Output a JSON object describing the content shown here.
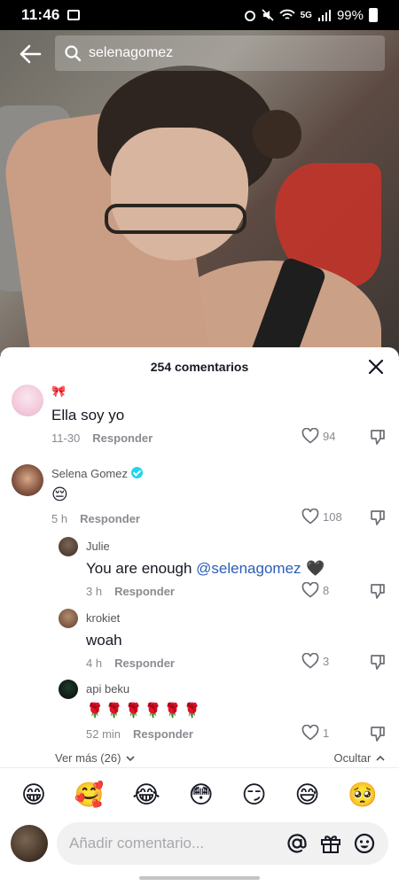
{
  "status_bar": {
    "time": "11:46",
    "network": "5G",
    "battery": "99%"
  },
  "search": {
    "query": "selenagomez"
  },
  "comments_sheet": {
    "title": "254 comentarios",
    "comments": [
      {
        "username": "🎀",
        "text": "Ella soy yo",
        "date": "11-30",
        "reply_label": "Responder",
        "likes": "94"
      },
      {
        "username": "Selena Gomez",
        "verified": true,
        "text": "😔",
        "date": "5 h",
        "reply_label": "Responder",
        "likes": "108",
        "replies": [
          {
            "username": "Julie",
            "text_before": "You are enough ",
            "mention": "@selenagomez",
            "text_after": " 🖤",
            "date": "3 h",
            "reply_label": "Responder",
            "likes": "8"
          },
          {
            "username": "krokiet",
            "text": "woah",
            "date": "4 h",
            "reply_label": "Responder",
            "likes": "3"
          },
          {
            "username": "api beku",
            "text": "🌹🌹🌹🌹🌹🌹",
            "date": "52 min",
            "reply_label": "Responder",
            "likes": "1"
          }
        ]
      }
    ],
    "view_more": "Ver más (26)",
    "hide": "Ocultar"
  },
  "emoji_bar": [
    "😁",
    "🥰",
    "😂",
    "😳",
    "😏",
    "😅",
    "🥺"
  ],
  "comment_input": {
    "placeholder": "Añadir comentario..."
  }
}
